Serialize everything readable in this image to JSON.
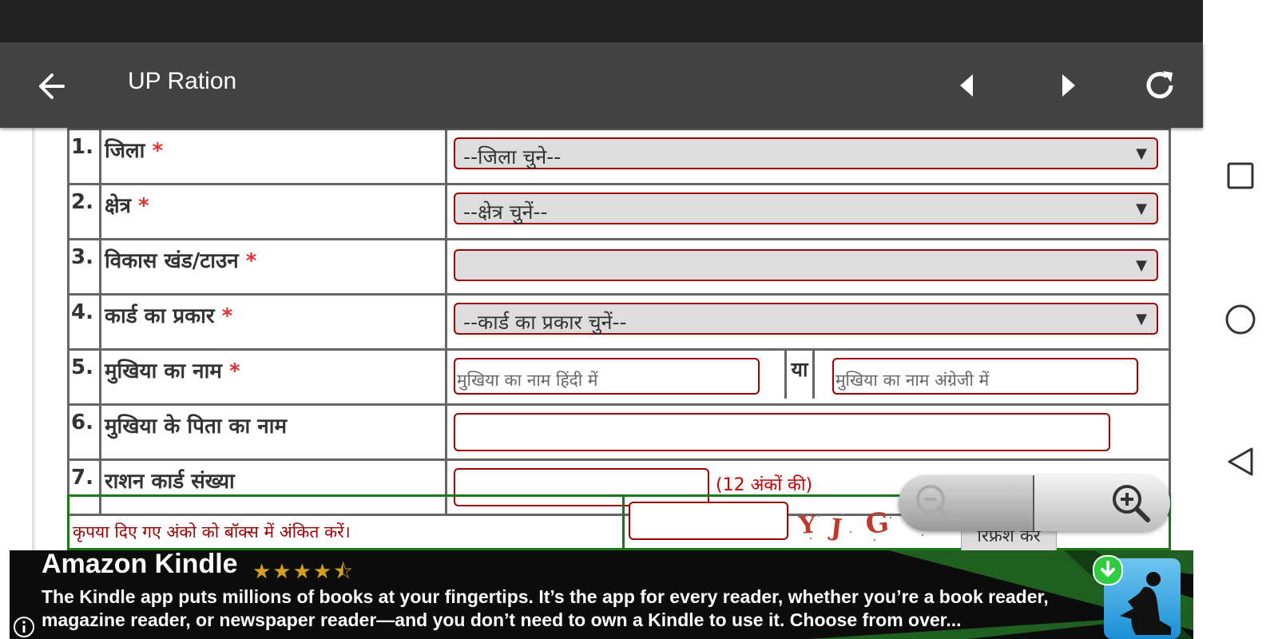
{
  "toolbar": {
    "title": "UP Ration"
  },
  "form": {
    "rows": [
      {
        "num": "1.",
        "label": "जिला",
        "required": "*",
        "select": "--जिला चुने--"
      },
      {
        "num": "2.",
        "label": "क्षेत्र",
        "required": "*",
        "select": "--क्षेत्र चुनें--"
      },
      {
        "num": "3.",
        "label": "विकास खंड/टाउन",
        "required": "*",
        "select": ""
      },
      {
        "num": "4.",
        "label": "कार्ड का प्रकार",
        "required": "*",
        "select": "--कार्ड का प्रकार चुनें--"
      },
      {
        "num": "5.",
        "label": "मुखिया का नाम",
        "required": "*",
        "placeholder_hindi": "मुखिया का नाम हिंदी में",
        "or": "या",
        "placeholder_english": "मुखिया का नाम अंग्रेजी में"
      },
      {
        "num": "6.",
        "label": "मुखिया के पिता का नाम"
      },
      {
        "num": "7.",
        "label": "राशन कार्ड संख्या",
        "hint": "(12 अंकों की)"
      }
    ],
    "captcha": {
      "label": "कृपया दिए गए अंको को बॉक्स में अंकित करें।",
      "refresh": "रिफ्रेश करें"
    }
  },
  "ad": {
    "title": "Amazon Kindle",
    "rating": 4.5,
    "stars": "★★★★⯪",
    "description": "The Kindle app puts millions of books at your fingertips. It’s the app for every reader, whether you’re a book reader, magazine reader, or newspaper reader—and you don’t need to own a Kindle to use it. Choose from over..."
  },
  "colors": {
    "toolbar": "#424242",
    "field_border": "#a00000",
    "required": "#e03030",
    "captcha_border": "#1a7a1a"
  }
}
